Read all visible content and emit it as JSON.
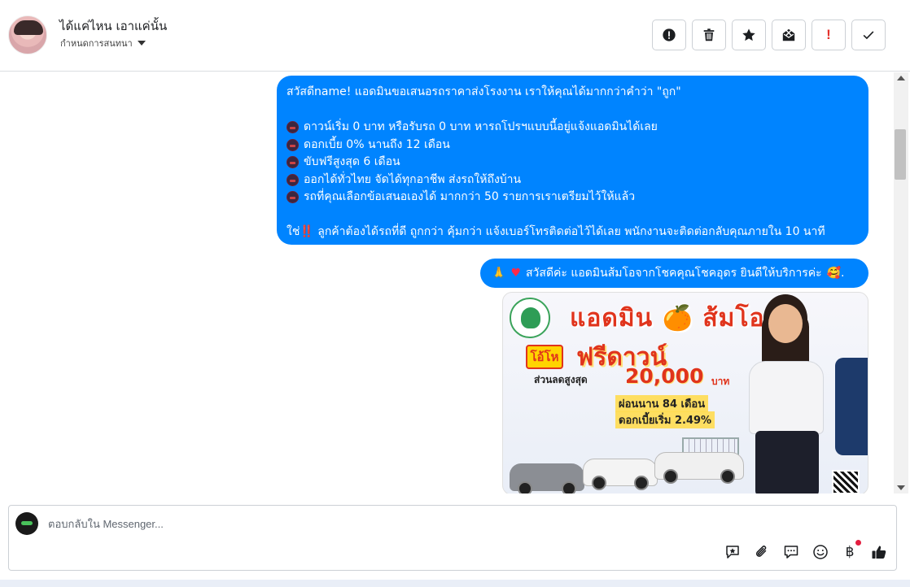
{
  "header": {
    "contact_name": "ได้แค่ไหน เอาแค่นั้น",
    "assign_label": "กำหนดการสนทนา",
    "actions": [
      {
        "name": "report-button",
        "icon": "alert-circle-icon"
      },
      {
        "name": "delete-button",
        "icon": "trash-icon"
      },
      {
        "name": "star-button",
        "icon": "star-icon"
      },
      {
        "name": "mark-unread-button",
        "icon": "envelope-x-icon"
      },
      {
        "name": "important-button",
        "icon": "exclamation-icon",
        "label": "!"
      },
      {
        "name": "done-button",
        "icon": "check-icon"
      }
    ]
  },
  "messages": {
    "m1": {
      "greeting": "สวัสดีname! แอดมินขอเสนอรถราคาส่งโรงงาน เราให้คุณได้มากกว่าคำว่า \"ถูก\"",
      "bullets": [
        "ดาวน์เริ่ม 0 บาท หรือรับรถ 0 บาท หารถโปรฯแบบนี้อยู่แจ้งแอดมินได้เลย",
        "ดอกเบี้ย 0% นานถึง 12 เดือน",
        "ขับฟรีสูงสุด 6 เดือน",
        "ออกได้ทั่วไทย จัดได้ทุกอาชีพ ส่งรถให้ถึงบ้าน",
        "รถที่คุณเลือกข้อเสนอเองได้ มากกว่า 50 รายการเราเตรียมไว้ให้แล้ว"
      ],
      "closing_prefix": "ใช่",
      "closing_bang": "‼️",
      "closing_text": "ลูกค้าต้องได้รถที่ดี ถูกกว่า คุ้มกว่า แจ้งเบอร์โทรติดต่อไว้ได้เลย พนักงานจะติดต่อกลับคุณภายใน 10 นาที"
    },
    "m2": {
      "emoji_pray": "🙏",
      "emoji_heart": "♥",
      "text": "สวัสดีค่ะ แอดมินส้มโอจากโชคคุณโชคอุดร ยินดีให้บริการค่ะ",
      "emoji_end": "🥰."
    },
    "promo": {
      "title": "แอดมิน 🍊 ส้มโอ",
      "badge": "โอ้โห",
      "headline": "ฟรีดาวน์",
      "discount_label": "ส่วนลดสูงสุด",
      "discount_amount": "20,000",
      "discount_unit": "บาท",
      "installment": "ผ่อนนาน 84 เดือน",
      "interest": "ดอกเบี้ยเริ่ม 2.49%"
    }
  },
  "composer": {
    "placeholder": "ตอบกลับใน Messenger...",
    "tools": [
      "saved-reply-icon",
      "attachment-icon",
      "chat-bubble-icon",
      "emoji-icon",
      "baht-payment-icon",
      "thumbs-up-icon"
    ],
    "baht_symbol": "฿"
  },
  "colors": {
    "bubble": "#0084ff",
    "accent_red": "#e4312b",
    "notification_dot": "#e41e3f"
  }
}
